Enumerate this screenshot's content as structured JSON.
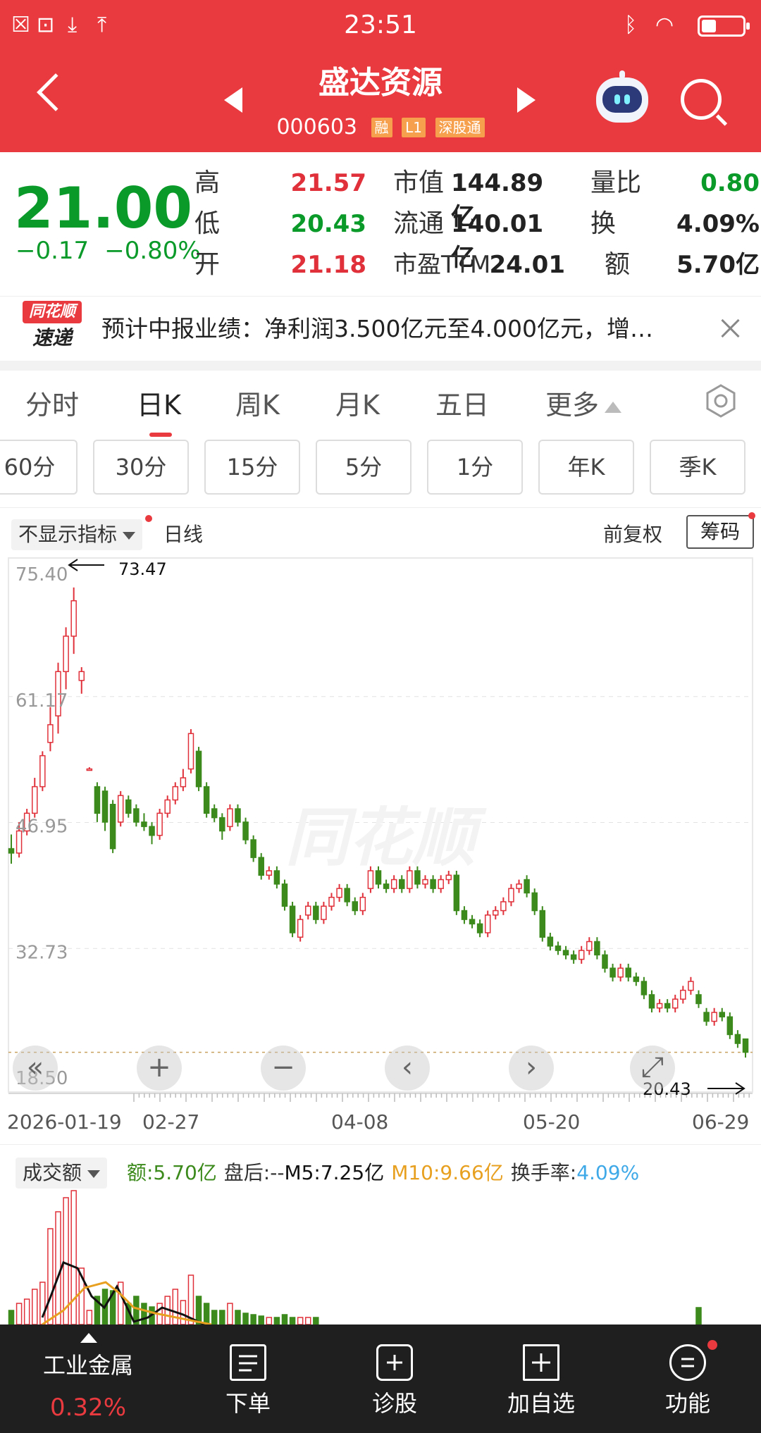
{
  "status_bar": {
    "time": "23:51",
    "battery_level": 0.35
  },
  "header": {
    "stock_name": "盛达资源",
    "stock_code": "000603",
    "tags": [
      "融",
      "L1",
      "深股通"
    ]
  },
  "quote": {
    "price": "21.00",
    "change": "−0.17",
    "change_pct": "−0.80%",
    "rows": [
      {
        "l1": "高",
        "v1": "21.57",
        "l2": "市值",
        "v2": "144.89亿",
        "l3": "量比",
        "v3": "0.80"
      },
      {
        "l1": "低",
        "v1": "20.43",
        "l2": "流通",
        "v2": "140.01亿",
        "l3": "换",
        "v3": "4.09%"
      },
      {
        "l1": "开",
        "v1": "21.18",
        "l2": "市盈TTM",
        "v2": "24.01",
        "l3": "额",
        "v3": "5.70亿"
      }
    ]
  },
  "news": {
    "logo_top": "同花顺",
    "logo_bottom": "速递",
    "text": "预计中报业绩：净利润3.500亿元至4.000亿元，增…"
  },
  "tabs": [
    "分时",
    "日K",
    "周K",
    "月K",
    "五日",
    "更多"
  ],
  "active_tab": "日K",
  "periods": [
    "60分",
    "30分",
    "15分",
    "5分",
    "1分",
    "年K",
    "季K"
  ],
  "chart_toolbar": {
    "indicator": "不显示指标",
    "line_type": "日线",
    "adjust": "前复权",
    "chips": "筹码"
  },
  "chart_data": {
    "type": "candlestick",
    "y_ticks": [
      "75.40",
      "61.17",
      "46.95",
      "32.73",
      "18.50"
    ],
    "ylim": [
      18.5,
      75.4
    ],
    "x_ticks": [
      "2026-01-19",
      "02-27",
      "04-08",
      "05-20",
      "06-29"
    ],
    "high_marker": "73.47",
    "low_marker": "20.43",
    "watermark": "同花顺",
    "up_color": "#e0313a",
    "down_color": "#3c8a1c",
    "candles": [
      [
        44.0,
        43.5,
        42.3,
        45.6
      ],
      [
        43.5,
        46.0,
        43.0,
        47.0
      ],
      [
        46.0,
        48.0,
        45.5,
        48.5
      ],
      [
        48.0,
        51.0,
        47.5,
        52.0
      ],
      [
        51.0,
        54.5,
        50.5,
        55.0
      ],
      [
        56.0,
        58.0,
        55.0,
        60.0
      ],
      [
        59.0,
        64.0,
        57.0,
        65.0
      ],
      [
        64.0,
        68.0,
        62.0,
        69.0
      ],
      [
        68.0,
        72.0,
        66.0,
        73.5
      ],
      [
        63.0,
        64.0,
        61.5,
        64.5
      ],
      [
        53.0,
        53.0,
        52.8,
        53.2
      ],
      [
        51.0,
        48.0,
        47.0,
        51.5
      ],
      [
        50.5,
        47.0,
        46.0,
        51.0
      ],
      [
        49.0,
        44.0,
        43.5,
        49.5
      ],
      [
        47.0,
        50.0,
        46.5,
        50.5
      ],
      [
        49.5,
        48.0,
        47.5,
        50.0
      ],
      [
        48.5,
        47.0,
        46.5,
        49.0
      ],
      [
        47.0,
        46.5,
        46.0,
        48.0
      ],
      [
        46.5,
        45.5,
        44.5,
        47.0
      ],
      [
        45.5,
        48.0,
        45.0,
        48.5
      ],
      [
        48.0,
        49.5,
        47.5,
        50.0
      ],
      [
        49.5,
        51.0,
        49.0,
        51.5
      ],
      [
        51.0,
        52.0,
        50.5,
        53.0
      ],
      [
        53.0,
        57.0,
        52.5,
        57.5
      ],
      [
        55.0,
        51.0,
        50.5,
        55.5
      ],
      [
        51.0,
        48.0,
        47.5,
        51.5
      ],
      [
        48.5,
        47.5,
        47.0,
        49.0
      ],
      [
        47.5,
        46.0,
        45.0,
        48.0
      ],
      [
        46.5,
        48.5,
        46.0,
        49.0
      ],
      [
        48.5,
        47.0,
        46.5,
        49.0
      ],
      [
        47.0,
        45.0,
        44.5,
        47.5
      ],
      [
        45.0,
        43.0,
        42.5,
        45.5
      ],
      [
        43.0,
        41.0,
        40.5,
        43.5
      ],
      [
        41.0,
        41.5,
        40.5,
        42.0
      ],
      [
        41.5,
        40.0,
        39.5,
        42.0
      ],
      [
        40.0,
        37.5,
        37.0,
        40.5
      ],
      [
        37.5,
        34.5,
        34.0,
        38.0
      ],
      [
        34.0,
        36.0,
        33.5,
        36.5
      ],
      [
        36.5,
        37.5,
        36.0,
        38.0
      ],
      [
        37.5,
        36.0,
        35.5,
        38.0
      ],
      [
        36.0,
        37.5,
        35.5,
        38.0
      ],
      [
        37.5,
        38.5,
        37.0,
        39.0
      ],
      [
        38.5,
        39.5,
        38.0,
        40.0
      ],
      [
        39.5,
        38.0,
        37.5,
        40.0
      ],
      [
        38.0,
        37.0,
        36.5,
        38.5
      ],
      [
        37.0,
        38.5,
        36.5,
        39.0
      ],
      [
        39.5,
        41.5,
        39.0,
        42.0
      ],
      [
        41.5,
        40.0,
        39.5,
        42.0
      ],
      [
        40.0,
        39.5,
        39.0,
        40.5
      ],
      [
        39.5,
        40.5,
        39.0,
        41.0
      ],
      [
        40.5,
        39.5,
        39.0,
        41.0
      ],
      [
        39.5,
        41.5,
        39.0,
        42.0
      ],
      [
        41.5,
        40.0,
        39.5,
        42.0
      ],
      [
        40.0,
        40.5,
        39.5,
        41.0
      ],
      [
        40.5,
        39.5,
        39.0,
        41.0
      ],
      [
        39.5,
        40.5,
        39.0,
        41.0
      ],
      [
        40.5,
        41.0,
        40.0,
        41.5
      ],
      [
        41.0,
        37.0,
        36.5,
        41.5
      ],
      [
        37.0,
        36.0,
        35.5,
        37.5
      ],
      [
        36.0,
        35.5,
        35.0,
        36.5
      ],
      [
        35.5,
        34.5,
        34.0,
        36.0
      ],
      [
        34.5,
        36.5,
        34.0,
        37.0
      ],
      [
        36.5,
        37.0,
        36.0,
        37.5
      ],
      [
        37.0,
        38.0,
        36.5,
        38.5
      ],
      [
        38.0,
        39.5,
        37.5,
        40.0
      ],
      [
        39.5,
        40.0,
        39.0,
        40.5
      ],
      [
        40.5,
        39.0,
        38.5,
        41.0
      ],
      [
        39.0,
        37.0,
        36.5,
        39.5
      ],
      [
        37.0,
        34.0,
        33.5,
        37.5
      ],
      [
        34.0,
        33.0,
        32.5,
        34.5
      ],
      [
        33.0,
        32.5,
        32.0,
        33.5
      ],
      [
        32.5,
        32.0,
        31.5,
        33.0
      ],
      [
        32.0,
        31.5,
        31.0,
        32.5
      ],
      [
        31.5,
        32.5,
        31.0,
        33.0
      ],
      [
        32.5,
        33.5,
        32.0,
        34.0
      ],
      [
        33.5,
        32.0,
        31.5,
        34.0
      ],
      [
        32.0,
        30.5,
        30.0,
        32.5
      ],
      [
        30.5,
        29.5,
        29.0,
        31.0
      ],
      [
        29.5,
        30.5,
        29.0,
        31.0
      ],
      [
        30.5,
        29.5,
        29.0,
        31.0
      ],
      [
        29.5,
        29.0,
        28.5,
        30.0
      ],
      [
        29.0,
        27.5,
        27.0,
        29.5
      ],
      [
        27.5,
        26.0,
        25.5,
        28.0
      ],
      [
        26.0,
        26.5,
        25.5,
        27.0
      ],
      [
        26.5,
        26.0,
        25.5,
        27.0
      ],
      [
        26.0,
        27.0,
        25.5,
        27.5
      ],
      [
        27.0,
        28.0,
        26.5,
        28.5
      ],
      [
        28.0,
        29.0,
        27.5,
        29.5
      ],
      [
        27.5,
        26.5,
        26.0,
        28.0
      ],
      [
        25.5,
        24.5,
        24.0,
        26.0
      ],
      [
        24.5,
        25.5,
        24.0,
        26.0
      ],
      [
        25.5,
        25.0,
        24.5,
        26.0
      ],
      [
        25.0,
        23.0,
        22.5,
        25.5
      ],
      [
        23.0,
        22.0,
        21.5,
        23.5
      ],
      [
        22.5,
        21.0,
        20.4,
        22.5
      ]
    ]
  },
  "volume": {
    "indicator": "成交额",
    "amount": "额:5.70亿",
    "after_hours": "盘后:--",
    "m5": "M5:7.25亿",
    "m10": "M10:9.66亿",
    "turnover_label": "换手率:",
    "turnover_value": "4.09%",
    "colors": {
      "amount": "#3c8a1c",
      "m5": "#111111",
      "m10": "#e8a020",
      "turnover": "#3fa9e8"
    }
  },
  "bottom_nav": {
    "sector_name": "工业金属",
    "sector_pct": "0.32%",
    "items": [
      "下单",
      "诊股",
      "加自选",
      "功能"
    ]
  }
}
